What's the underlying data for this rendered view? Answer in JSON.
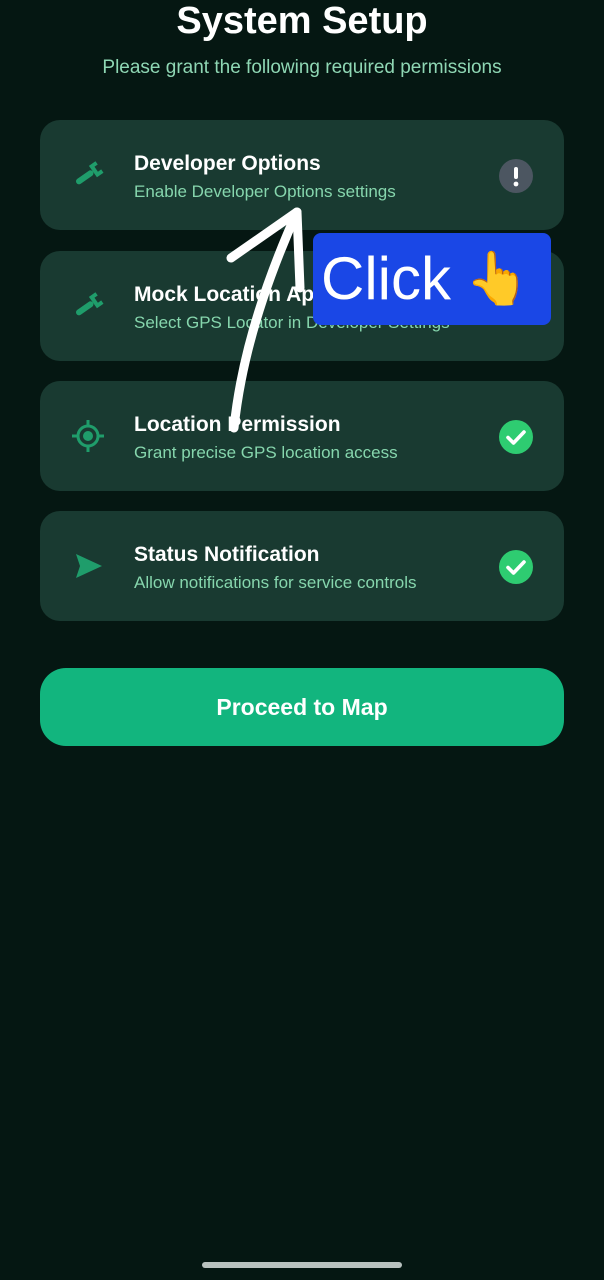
{
  "header": {
    "title": "System Setup",
    "subtitle": "Please grant the following required permissions"
  },
  "permissions": [
    {
      "title": "Developer Options",
      "description": "Enable Developer Options settings",
      "icon": "wrench-icon",
      "status": "warning",
      "status_symbol": "!"
    },
    {
      "title": "Mock Location App",
      "description": "Select GPS Locator in Developer Settings",
      "icon": "wrench-icon",
      "status": "obscured"
    },
    {
      "title": "Location Permission",
      "description": "Grant precise GPS location access",
      "icon": "crosshair-icon",
      "status": "granted"
    },
    {
      "title": "Status Notification",
      "description": "Allow notifications for service controls",
      "icon": "send-icon",
      "status": "granted"
    }
  ],
  "proceed_button": {
    "label": "Proceed to Map"
  },
  "annotation": {
    "label": "Click",
    "emoji": "👆"
  },
  "colors": {
    "background": "#051712",
    "card": "#193a31",
    "accent": "#12b57e",
    "subtitle_text": "#8fd7b4",
    "granted": "#2ecc71",
    "warning_badge": "#4c5661",
    "annotation_bg": "#1a47e6"
  }
}
